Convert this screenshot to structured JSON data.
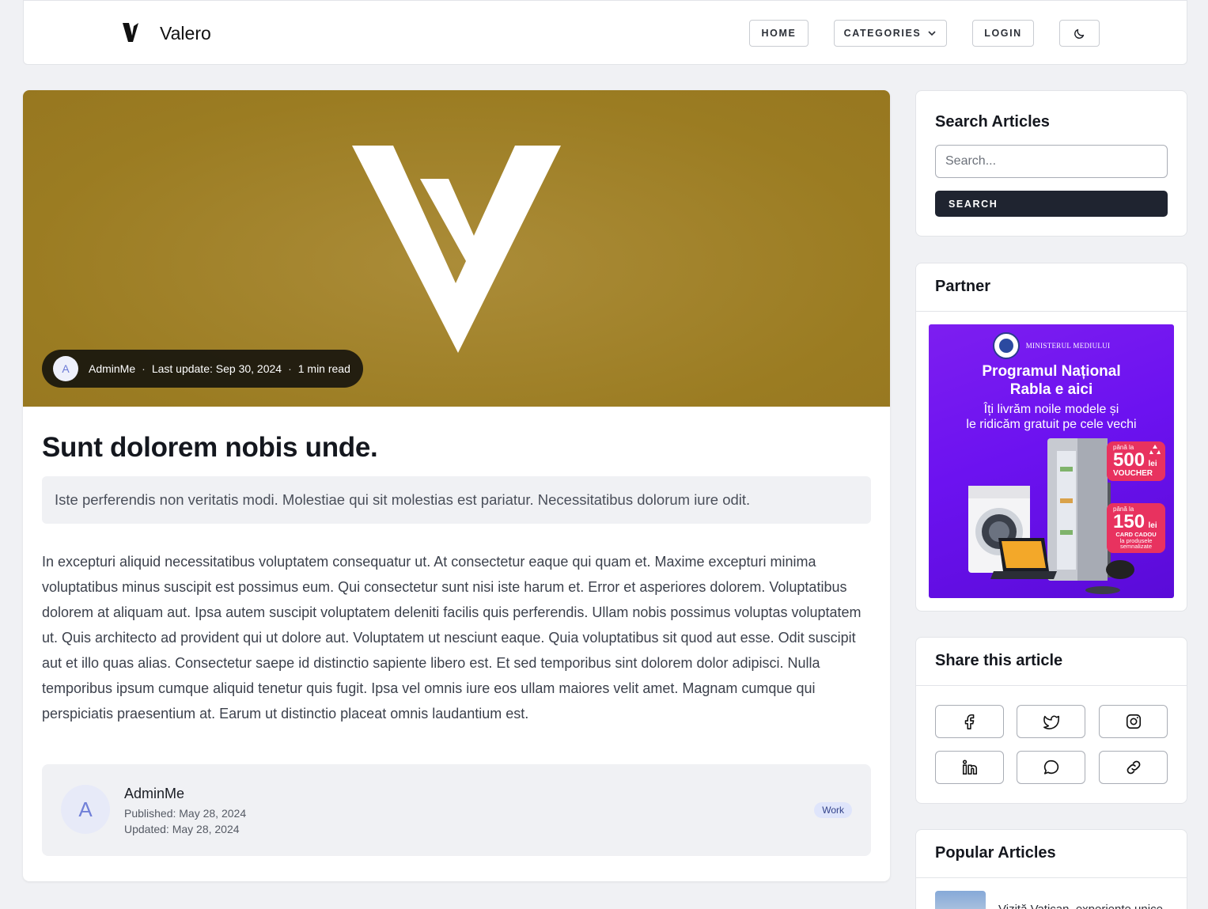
{
  "header": {
    "brand": "Valero",
    "nav": {
      "home": "HOME",
      "categories": "CATEGORIES",
      "login": "LOGIN"
    }
  },
  "article": {
    "author_initial": "A",
    "author": "AdminMe",
    "last_update": "Last update: Sep 30, 2024",
    "read_time": "1 min read",
    "separator": "·",
    "title": "Sunt dolorem nobis unde.",
    "lead": "Iste perferendis non veritatis modi. Molestiae qui sit molestias est pariatur. Necessitatibus dolorum iure odit.",
    "body": "In excepturi aliquid necessitatibus voluptatem consequatur ut. At consectetur eaque qui quam et. Maxime excepturi minima voluptatibus minus suscipit est possimus eum. Qui consectetur sunt nisi iste harum et. Error et asperiores dolorem. Voluptatibus dolorem at aliquam aut. Ipsa autem suscipit voluptatem deleniti facilis quis perferendis. Ullam nobis possimus voluptas voluptatem ut. Quis architecto ad provident qui ut dolore aut. Voluptatem ut nesciunt eaque. Quia voluptatibus sit quod aut esse. Odit suscipit aut et illo quas alias. Consectetur saepe id distinctio sapiente libero est. Et sed temporibus sint dolorem dolor adipisci. Nulla temporibus ipsum cumque aliquid tenetur quis fugit. Ipsa vel omnis iure eos ullam maiores velit amet. Magnam cumque qui perspiciatis praesentium at. Earum ut distinctio placeat omnis laudantium est.",
    "author_box": {
      "initial": "A",
      "name": "AdminMe",
      "published": "Published: May 28, 2024",
      "updated": "Updated: May 28, 2024",
      "tag": "Work"
    }
  },
  "sidebar": {
    "search": {
      "title": "Search Articles",
      "placeholder": "Search...",
      "button": "SEARCH"
    },
    "partner": {
      "title": "Partner",
      "ad": {
        "ministry": "MINISTERUL MEDIULUI",
        "headline_1": "Programul Național",
        "headline_2": "Rabla e aici",
        "sub_1": "Îți livrăm noile modele și",
        "sub_2": "le ridicăm gratuit pe cele vechi",
        "badge1_small": "până la",
        "badge1_value": "500",
        "badge1_unit": "lei",
        "badge1_label": "VOUCHER",
        "badge2_small": "până la",
        "badge2_value": "150",
        "badge2_unit": "lei",
        "badge2_label": "CARD CADOU",
        "badge2_note": "la produsele semnalizate"
      }
    },
    "share": {
      "title": "Share this article",
      "icons": [
        "facebook-icon",
        "twitter-icon",
        "instagram-icon",
        "linkedin-icon",
        "message-icon",
        "link-icon"
      ]
    },
    "popular": {
      "title": "Popular Articles",
      "items": [
        {
          "title": "Vizită Vatican, experiențe unice"
        }
      ]
    }
  },
  "colors": {
    "hero": "#9f8027",
    "dark_button": "#1f2430",
    "ad_purple": "#6c12f0",
    "ad_badge": "#e8325f"
  }
}
